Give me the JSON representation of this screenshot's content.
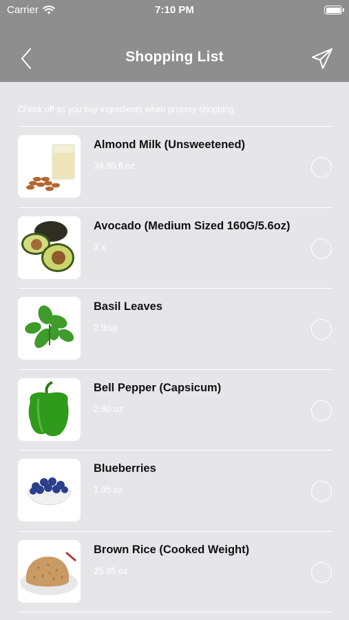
{
  "status_bar": {
    "carrier": "Carrier",
    "time": "7:10 PM"
  },
  "nav": {
    "title": "Shopping List",
    "back_icon": "chevron-left-icon",
    "send_icon": "paper-plane-icon"
  },
  "hint": "Check off as you buy ingredients when grocery shopping.",
  "items": [
    {
      "name": "Almond Milk (Unsweetened)",
      "qty": "34.90 fl oz"
    },
    {
      "name": "Avocado (Medium Sized 160G/5.6oz)",
      "qty": "3 x"
    },
    {
      "name": "Basil Leaves",
      "qty": "2 tbsp"
    },
    {
      "name": "Bell Pepper (Capsicum)",
      "qty": "2.80 oz"
    },
    {
      "name": "Blueberries",
      "qty": "1.95 oz"
    },
    {
      "name": "Brown Rice (Cooked Weight)",
      "qty": "25.95 oz"
    }
  ]
}
